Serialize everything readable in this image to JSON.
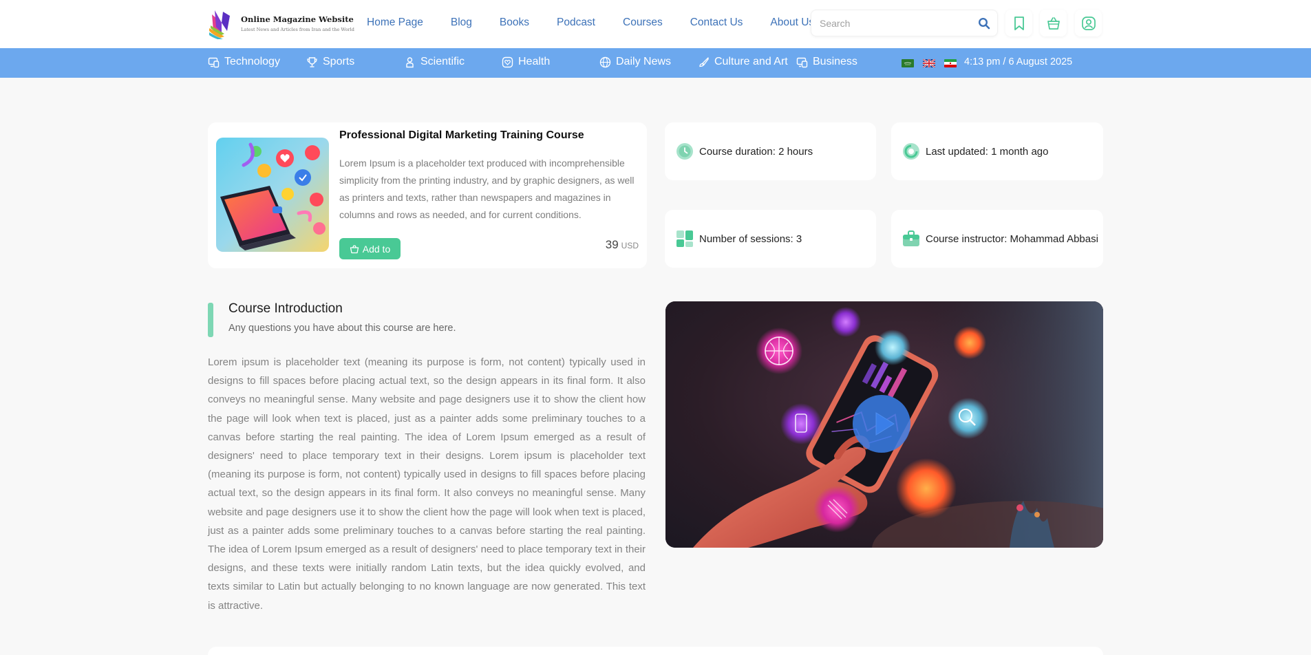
{
  "header": {
    "logo_title": "Online Magazine Website",
    "logo_subtitle": "Latest News and Articles from Iran and the World",
    "nav": [
      {
        "label": "Home Page"
      },
      {
        "label": "Blog"
      },
      {
        "label": "Books"
      },
      {
        "label": "Podcast"
      },
      {
        "label": "Courses"
      },
      {
        "label": "Contact Us"
      },
      {
        "label": "About Us"
      }
    ],
    "search_placeholder": "Search",
    "icons": [
      "search-icon",
      "bookmark-icon",
      "basket-icon",
      "user-icon"
    ]
  },
  "categories": [
    {
      "label": "Technology",
      "icon": "monitor-icon"
    },
    {
      "label": "Sports",
      "icon": "trophy-icon"
    },
    {
      "label": "Scientific",
      "icon": "flask-icon"
    },
    {
      "label": "Health",
      "icon": "heart-icon"
    },
    {
      "label": "Daily News",
      "icon": "globe-icon"
    },
    {
      "label": "Culture and Art",
      "icon": "brush-icon"
    },
    {
      "label": "Business",
      "icon": "briefcase-icon"
    }
  ],
  "datetime": "4:13 pm / 6 August 2025",
  "course": {
    "title": "Professional Digital Marketing Training Course",
    "description": "Lorem Ipsum is a placeholder text produced with incomprehensible simplicity from the printing industry, and by graphic designers, as well as printers and texts, rather than newspapers and magazines in columns and rows as needed, and for current conditions.",
    "add_label": "Add to",
    "price": "39",
    "currency": "USD"
  },
  "info": {
    "duration": "Course duration: 2 hours",
    "updated": "Last updated: 1 month ago",
    "sessions": "Number of sessions: 3",
    "instructor": "Course instructor: Mohammad Abbasi"
  },
  "intro": {
    "title": "Course Introduction",
    "subtitle": "Any questions you have about this course are here.",
    "body": "Lorem ipsum is placeholder text (meaning its purpose is form, not content) typically used in designs to fill spaces before placing actual text, so the design appears in its final form. It also conveys no meaningful sense. Many website and page designers use it to show the client how the page will look when text is placed, just as a painter adds some preliminary touches to a canvas before starting the real painting. The idea of Lorem Ipsum emerged as a result of designers' need to place temporary text in their designs. Lorem ipsum is placeholder text (meaning its purpose is form, not content) typically used in designs to fill spaces before placing actual text, so the design appears in its final form. It also conveys no meaningful sense. Many website and page designers use it to show the client how the page will look when text is placed, just as a painter adds some preliminary touches to a canvas before starting the real painting. The idea of Lorem Ipsum emerged as a result of designers' need to place temporary text in their designs, and these texts were initially random Latin texts, but the idea quickly evolved, and texts similar to Latin but actually belonging to no known language are now generated. This text is attractive."
  },
  "colors": {
    "nav_text": "#3d72b8",
    "category_bar": "#6ca8ee",
    "accent_green": "#49c995",
    "page_bg": "#f8f8f8"
  }
}
